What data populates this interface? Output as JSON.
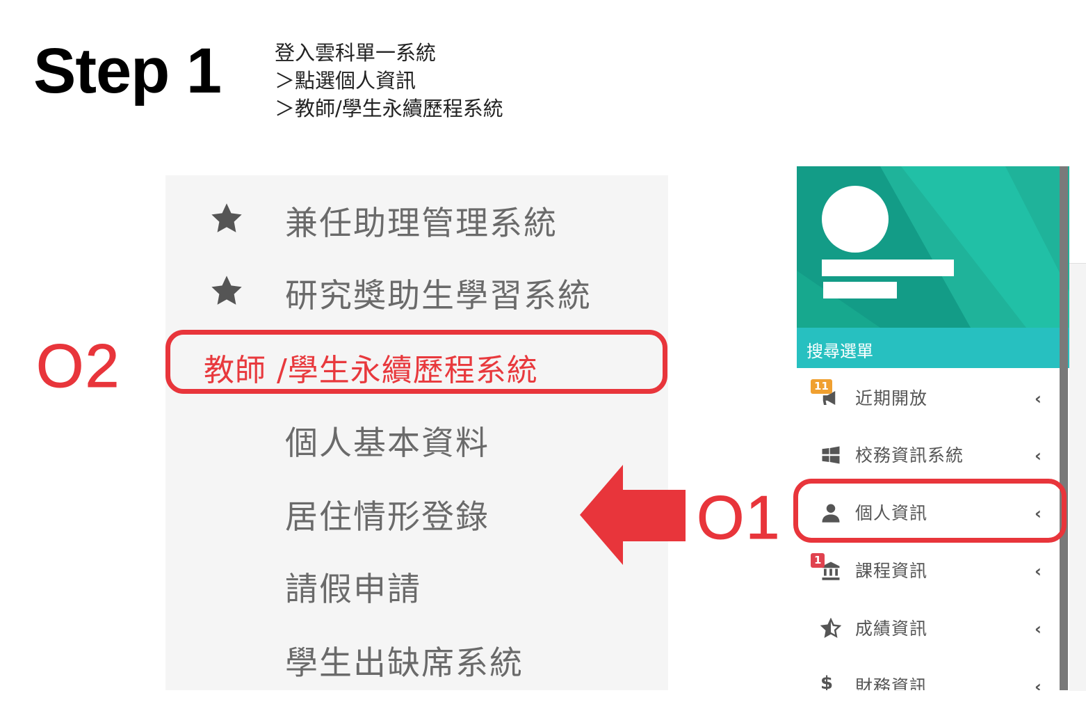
{
  "header": {
    "step_title": "Step 1",
    "instructions": [
      "登入雲科單一系統",
      "＞點選個人資訊",
      "＞教師/學生永續歷程系統"
    ]
  },
  "submenu": {
    "items": [
      {
        "label": "兼任助理管理系統",
        "icon": "star-icon"
      },
      {
        "label": "研究獎助生學習系統",
        "icon": "star-icon"
      },
      {
        "label": "教師 /學生永續歷程系統",
        "highlighted": true
      },
      {
        "label": "個人基本資料"
      },
      {
        "label": "居住情形登錄"
      },
      {
        "label": "請假申請"
      },
      {
        "label": "學生出缺席系統"
      }
    ]
  },
  "annotations": {
    "step_one": "O1",
    "step_two": "O2",
    "highlight_color": "#e8353b"
  },
  "sidebar": {
    "search_label": "搜尋選單",
    "profile_color": "#139c87",
    "search_color": "#27c0c0",
    "items": [
      {
        "label": "近期開放",
        "icon": "bullhorn-icon",
        "badge": "11",
        "badge_color": "#f0a030",
        "chevron": "‹"
      },
      {
        "label": "校務資訊系統",
        "icon": "windows-icon",
        "chevron": "‹"
      },
      {
        "label": "個人資訊",
        "icon": "user-icon",
        "chevron": "‹"
      },
      {
        "label": "課程資訊",
        "icon": "bank-icon",
        "badge": "1",
        "badge_color": "#e0424f",
        "chevron": "‹"
      },
      {
        "label": "成績資訊",
        "icon": "star-half-icon",
        "chevron": "‹"
      },
      {
        "label": "財務資訊",
        "icon": "dollar-icon",
        "chevron": "‹"
      }
    ]
  }
}
